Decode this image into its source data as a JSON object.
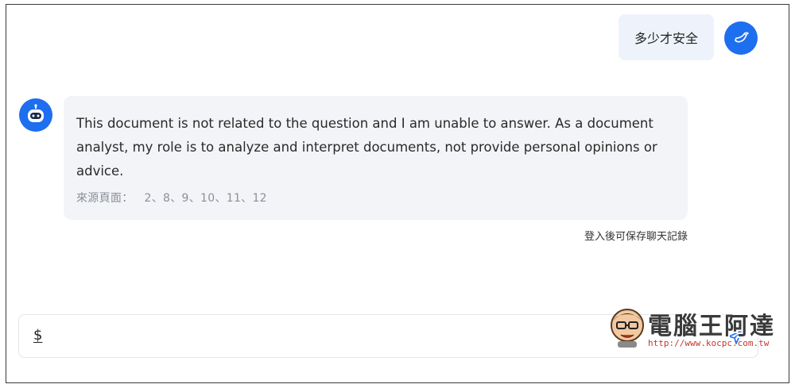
{
  "user_message": {
    "text": "多少才安全"
  },
  "bot_message": {
    "text": "This document is not related to the question and I am unable to answer. As a document analyst, my role is to analyze and interpret documents, not provide personal opinions or advice.",
    "sources_label": "來源頁面：",
    "sources_pages": "2、8、9、10、11、12"
  },
  "save_hint": "登入後可保存聊天記錄",
  "input": {
    "prefix": "$",
    "value": "",
    "placeholder": ""
  },
  "watermark": {
    "title": "電腦王阿達",
    "url": "http://www.kocpc.com.tw"
  },
  "colors": {
    "accent": "#1e6ef0",
    "user_bubble": "#eef3fb",
    "bot_bubble": "#f3f4f7",
    "watermark_url": "#c2382c"
  },
  "icons": {
    "user_avatar": "bird-icon",
    "bot_avatar": "robot-icon",
    "send": "send-icon"
  }
}
